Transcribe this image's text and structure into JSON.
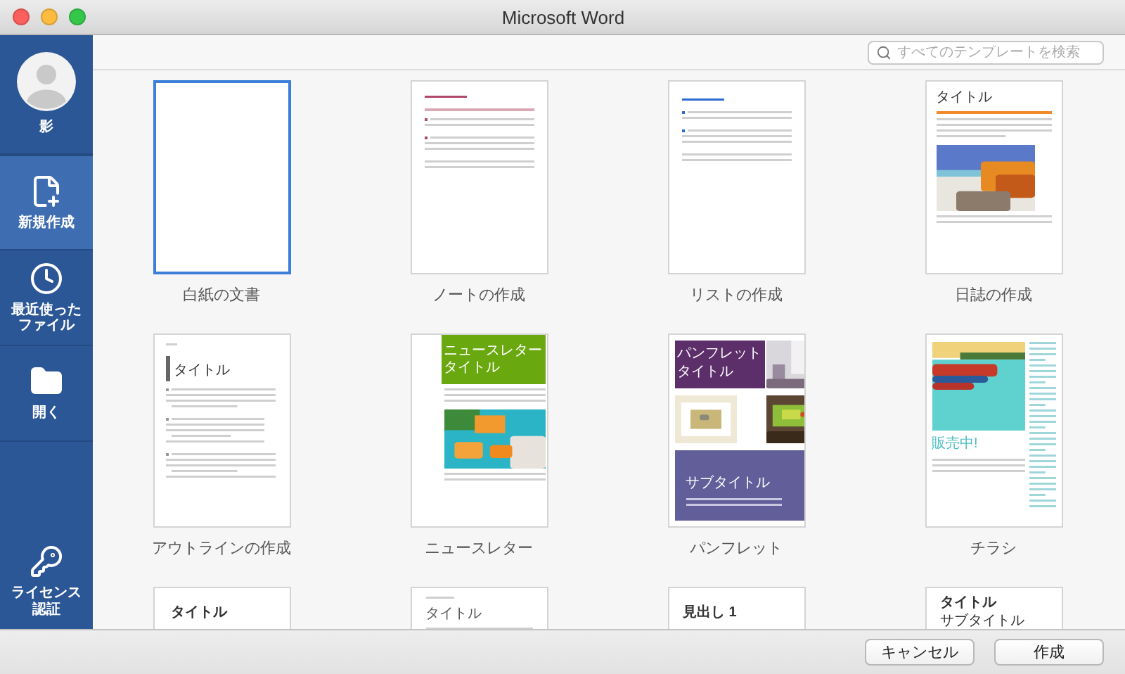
{
  "window": {
    "title": "Microsoft Word"
  },
  "sidebar": {
    "user": {
      "name": "影"
    },
    "items": [
      {
        "kind": "new",
        "label": "新規作成",
        "selected": true
      },
      {
        "kind": "recent",
        "label": "最近使ったファイル",
        "selected": false
      },
      {
        "kind": "open",
        "label": "開く",
        "selected": false
      }
    ],
    "footer": {
      "kind": "license",
      "label": "ライセンス認証"
    }
  },
  "search": {
    "placeholder": "すべてのテンプレートを検索"
  },
  "templates": [
    {
      "label": "白紙の文書",
      "selected": true,
      "preview": {
        "kind": "blank"
      }
    },
    {
      "label": "ノートの作成",
      "selected": false,
      "preview": {
        "kind": "note"
      }
    },
    {
      "label": "リストの作成",
      "selected": false,
      "preview": {
        "kind": "list"
      }
    },
    {
      "label": "日誌の作成",
      "selected": false,
      "preview": {
        "kind": "journal",
        "title": "タイトル"
      }
    },
    {
      "label": "アウトラインの作成",
      "selected": false,
      "preview": {
        "kind": "outline",
        "title": "タイトル"
      }
    },
    {
      "label": "ニュースレター",
      "selected": false,
      "preview": {
        "kind": "newsletter",
        "title": [
          "ニュースレター",
          "タイトル"
        ]
      }
    },
    {
      "label": "パンフレット",
      "selected": false,
      "preview": {
        "kind": "brochure",
        "title": [
          "パンフレット",
          "タイトル"
        ],
        "subtitle": "サブタイトル"
      }
    },
    {
      "label": "チラシ",
      "selected": false,
      "preview": {
        "kind": "flyer",
        "title": "販売中!"
      }
    },
    {
      "selected": false,
      "preview": {
        "kind": "title",
        "title": "タイトル"
      }
    },
    {
      "selected": false,
      "preview": {
        "kind": "report",
        "title": "タイトル"
      }
    },
    {
      "selected": false,
      "preview": {
        "kind": "heading",
        "title": "見出し 1"
      }
    },
    {
      "selected": false,
      "preview": {
        "kind": "title",
        "title": "タイトル",
        "subtitle": "サブタイトル"
      }
    }
  ],
  "buttons": [
    "キャンセル",
    "作成"
  ]
}
